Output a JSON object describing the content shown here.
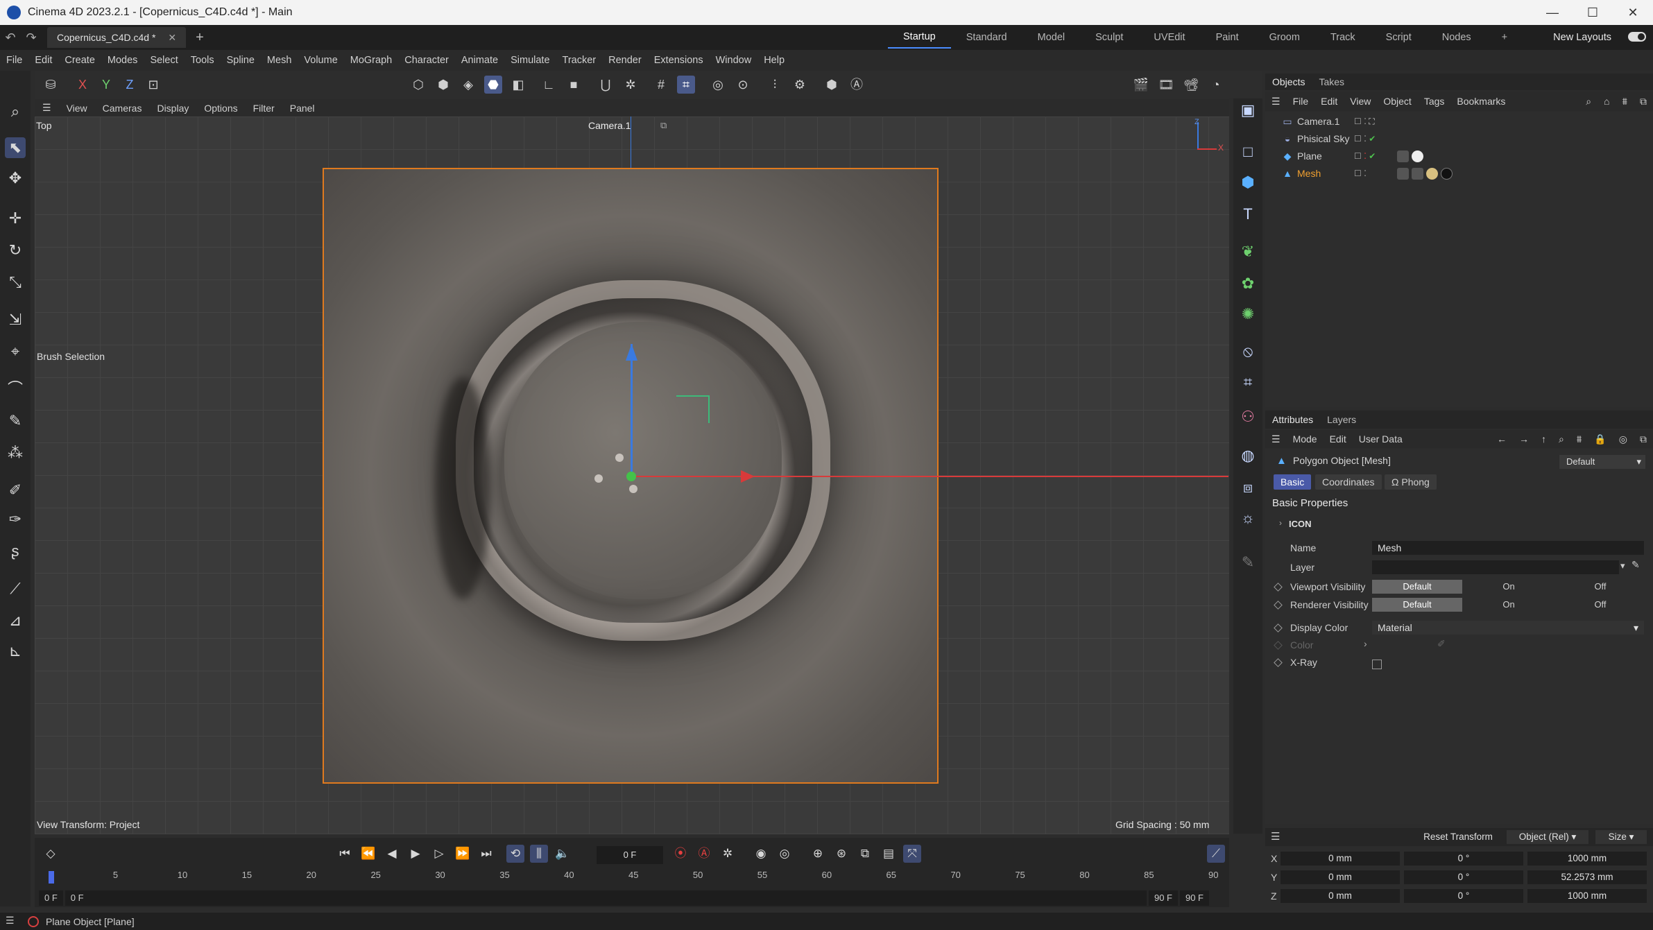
{
  "window": {
    "title": "Cinema 4D 2023.2.1 - [Copernicus_C4D.c4d *] - Main",
    "controls": [
      "—",
      "☐",
      "✕"
    ]
  },
  "tabs": {
    "document_tab": "Copernicus_C4D.c4d *",
    "layouts": [
      "Startup",
      "Standard",
      "Model",
      "Sculpt",
      "UVEdit",
      "Paint",
      "Groom",
      "Track",
      "Script",
      "Nodes"
    ],
    "active_layout": "Startup",
    "new_layouts": "New Layouts"
  },
  "menu": [
    "File",
    "Edit",
    "Create",
    "Modes",
    "Select",
    "Tools",
    "Spline",
    "Mesh",
    "Volume",
    "MoGraph",
    "Character",
    "Animate",
    "Simulate",
    "Tracker",
    "Render",
    "Extensions",
    "Window",
    "Help"
  ],
  "toolbar": {
    "axis_x": "X",
    "axis_y": "Y",
    "axis_z": "Z"
  },
  "viewport": {
    "menu": [
      "View",
      "Cameras",
      "Display",
      "Options",
      "Filter",
      "Panel"
    ],
    "projection_label": "Top",
    "camera_label": "Camera.1",
    "brush_selection": "Brush Selection",
    "view_transform": "View Transform: Project",
    "grid_spacing": "Grid Spacing : 50 mm",
    "corner_z": "Z",
    "corner_x": "X"
  },
  "timeline": {
    "current_frame": "0 F",
    "ticks": [
      "0",
      "5",
      "10",
      "15",
      "20",
      "25",
      "30",
      "35",
      "40",
      "45",
      "50",
      "55",
      "60",
      "65",
      "70",
      "75",
      "80",
      "85",
      "90"
    ],
    "range_start": "0 F",
    "range_start2": "0 F",
    "range_end": "90 F",
    "range_end2": "90 F"
  },
  "status_bar": {
    "text": "Plane Object [Plane]"
  },
  "objects_panel": {
    "tabs": [
      "Objects",
      "Takes"
    ],
    "menu": [
      "File",
      "Edit",
      "View",
      "Object",
      "Tags",
      "Bookmarks"
    ],
    "objects": [
      {
        "name": "Camera.1",
        "icon": "camera-icon",
        "selected": false
      },
      {
        "name": "Phisical Sky",
        "icon": "sky-icon",
        "selected": false
      },
      {
        "name": "Plane",
        "icon": "plane-icon",
        "selected": false
      },
      {
        "name": "Mesh",
        "icon": "mesh-icon",
        "selected": true
      }
    ]
  },
  "attributes_panel": {
    "tabs": [
      "Attributes",
      "Layers"
    ],
    "menu": [
      "Mode",
      "Edit",
      "User Data"
    ],
    "object_title": "Polygon Object [Mesh]",
    "preset": "Default",
    "subtabs": [
      "Basic",
      "Coordinates",
      "Phong"
    ],
    "active_subtab": "Basic",
    "section": "Basic Properties",
    "icon_group": "ICON",
    "name_label": "Name",
    "name_value": "Mesh",
    "layer_label": "Layer",
    "viewport_visibility_label": "Viewport Visibility",
    "renderer_visibility_label": "Renderer Visibility",
    "visibility_options": [
      "Default",
      "On",
      "Off"
    ],
    "display_color_label": "Display Color",
    "display_color_value": "Material",
    "color_label": "Color",
    "xray_label": "X-Ray"
  },
  "coordinates": {
    "reset_transform": "Reset Transform",
    "mode": "Object (Rel)",
    "size_mode": "Size",
    "rows": [
      {
        "axis": "X",
        "pos": "0 mm",
        "rot": "0 °",
        "size": "1000 mm"
      },
      {
        "axis": "Y",
        "pos": "0 mm",
        "rot": "0 °",
        "size": "52.2573 mm"
      },
      {
        "axis": "Z",
        "pos": "0 mm",
        "rot": "0 °",
        "size": "1000 mm"
      }
    ]
  },
  "colors": {
    "selection_orange": "#e07a1e",
    "accent_blue": "#4a8cff",
    "axis_x_red": "#d83a3a",
    "axis_y_blue": "#3a7ae0",
    "origin_green": "#44c24a"
  }
}
